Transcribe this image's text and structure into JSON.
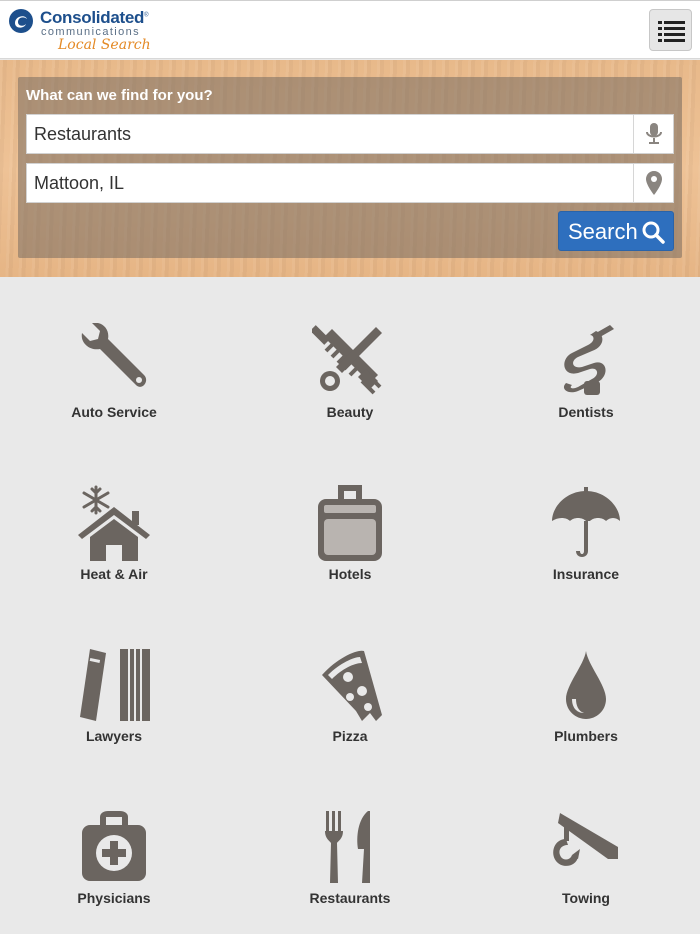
{
  "header": {
    "logo": {
      "brand": "Consolidated",
      "trademark": "®",
      "sub": "communications",
      "product": "Local Search"
    },
    "menu_icon": "list-menu-icon"
  },
  "search": {
    "heading": "What can we find for you?",
    "what_value": "Restaurants",
    "where_value": "Mattoon, IL",
    "mic_icon": "microphone-icon",
    "location_icon": "map-pin-icon",
    "button_label": "Search",
    "button_icon": "magnifier-icon",
    "button_color": "#2e6fbe"
  },
  "categories": [
    {
      "label": "Auto Service",
      "icon": "wrench-icon"
    },
    {
      "label": "Beauty",
      "icon": "comb-scissors-icon"
    },
    {
      "label": "Dentists",
      "icon": "dental-drill-icon"
    },
    {
      "label": "Heat & Air",
      "icon": "house-snowflake-icon"
    },
    {
      "label": "Hotels",
      "icon": "suitcase-icon"
    },
    {
      "label": "Insurance",
      "icon": "umbrella-icon"
    },
    {
      "label": "Lawyers",
      "icon": "law-books-icon"
    },
    {
      "label": "Pizza",
      "icon": "pizza-slice-icon"
    },
    {
      "label": "Plumbers",
      "icon": "water-drop-icon"
    },
    {
      "label": "Physicians",
      "icon": "first-aid-kit-icon"
    },
    {
      "label": "Restaurants",
      "icon": "fork-knife-icon"
    },
    {
      "label": "Towing",
      "icon": "tow-hook-icon"
    }
  ],
  "colors": {
    "icon": "#6b6560",
    "brand_blue": "#1d4f8c",
    "brand_orange": "#e48a26"
  }
}
